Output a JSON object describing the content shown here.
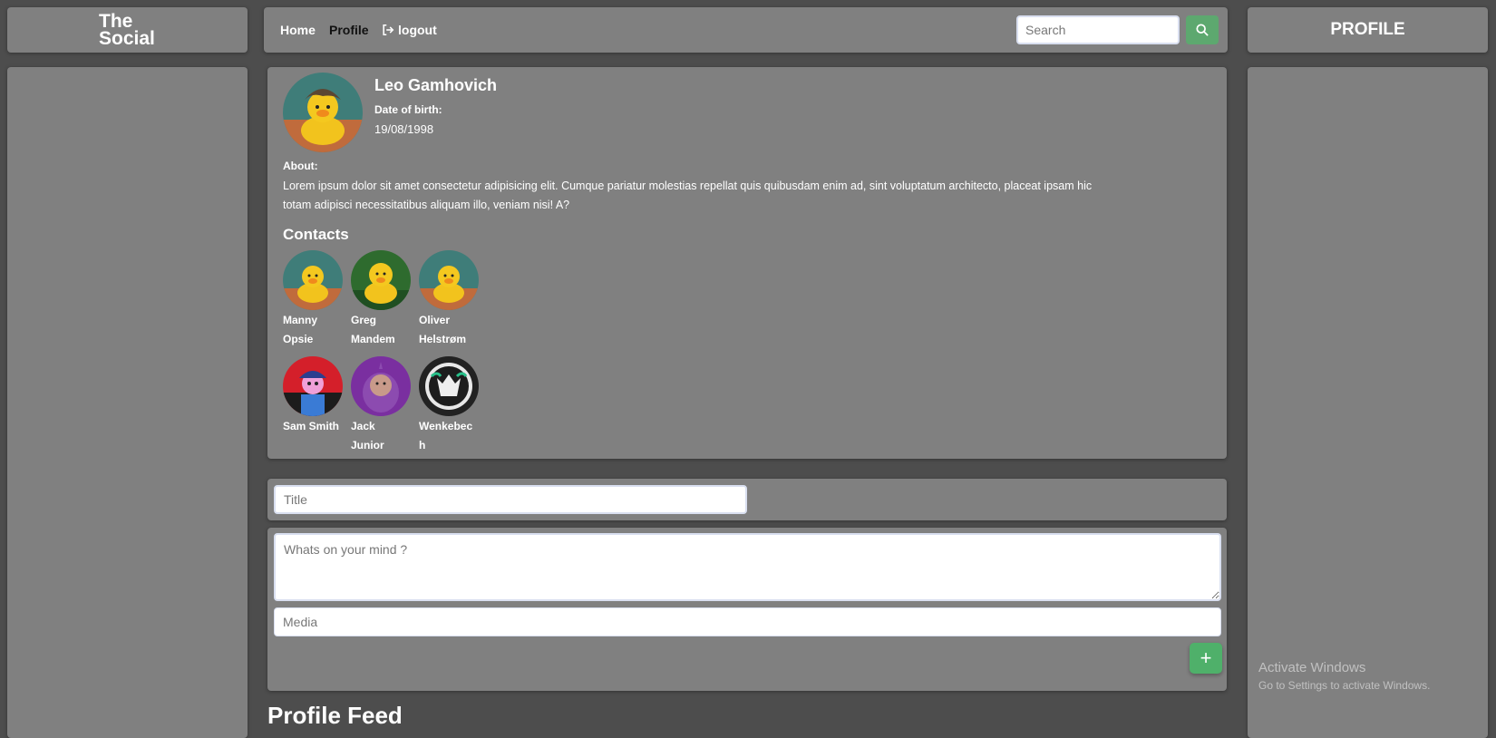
{
  "brand": {
    "line1": "The",
    "line2": "Social"
  },
  "nav": {
    "home": "Home",
    "profile": "Profile",
    "logout": "logout",
    "search_placeholder": "Search"
  },
  "right_sidebar": {
    "title": "PROFILE",
    "watermark_title": "Activate Windows",
    "watermark_sub": "Go to Settings to activate Windows."
  },
  "profile": {
    "name": "Leo Gamhovich",
    "dob_label": "Date of birth:",
    "dob": "19/08/1998",
    "about_label": "About:",
    "about": "Lorem ipsum dolor sit amet consectetur adipisicing elit. Cumque pariatur molestias repellat quis quibusdam enim ad, sint voluptatum architecto, placeat ipsam hic totam adipisci necessitatibus aliquam illo, veniam nisi! A?",
    "contacts_heading": "Contacts",
    "contacts": [
      {
        "name": "Manny Opsie"
      },
      {
        "name": "Greg Mandem"
      },
      {
        "name": "Oliver Helstrøm"
      },
      {
        "name": "Sam Smith"
      },
      {
        "name": "Jack Junior"
      },
      {
        "name": "Wenkebech"
      }
    ]
  },
  "post_form": {
    "title_placeholder": "Title",
    "body_placeholder": "Whats on your mind ?",
    "media_placeholder": "Media",
    "add_label": "+"
  },
  "feed": {
    "heading": "Profile Feed"
  },
  "colors": {
    "page_bg": "#4d4d4d",
    "panel_bg": "#808080",
    "accent_green": "#4fb06a"
  }
}
